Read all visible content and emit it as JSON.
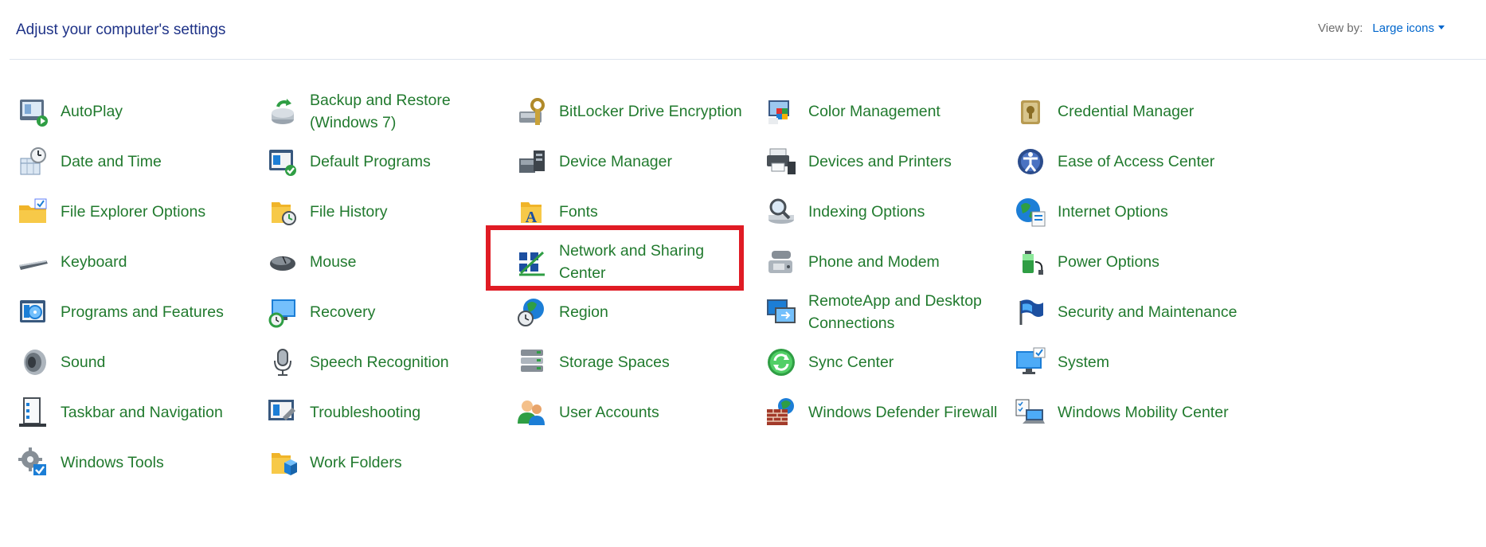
{
  "header": {
    "title": "Adjust your computer's settings",
    "view_by_label": "View by:",
    "view_by_value": "Large icons"
  },
  "items": [
    {
      "label": "AutoPlay",
      "icon": "autoplay-icon"
    },
    {
      "label": "Backup and Restore (Windows 7)",
      "icon": "backup-restore-icon"
    },
    {
      "label": "BitLocker Drive Encryption",
      "icon": "bitlocker-icon"
    },
    {
      "label": "Color Management",
      "icon": "color-management-icon"
    },
    {
      "label": "Credential Manager",
      "icon": "credential-manager-icon"
    },
    {
      "label": "Date and Time",
      "icon": "date-time-icon"
    },
    {
      "label": "Default Programs",
      "icon": "default-programs-icon"
    },
    {
      "label": "Device Manager",
      "icon": "device-manager-icon"
    },
    {
      "label": "Devices and Printers",
      "icon": "devices-printers-icon"
    },
    {
      "label": "Ease of Access Center",
      "icon": "ease-of-access-icon"
    },
    {
      "label": "File Explorer Options",
      "icon": "file-explorer-options-icon"
    },
    {
      "label": "File History",
      "icon": "file-history-icon"
    },
    {
      "label": "Fonts",
      "icon": "fonts-icon"
    },
    {
      "label": "Indexing Options",
      "icon": "indexing-options-icon"
    },
    {
      "label": "Internet Options",
      "icon": "internet-options-icon"
    },
    {
      "label": "Keyboard",
      "icon": "keyboard-icon"
    },
    {
      "label": "Mouse",
      "icon": "mouse-icon"
    },
    {
      "label": "Network and Sharing Center",
      "icon": "network-sharing-icon"
    },
    {
      "label": "Phone and Modem",
      "icon": "phone-modem-icon"
    },
    {
      "label": "Power Options",
      "icon": "power-options-icon"
    },
    {
      "label": "Programs and Features",
      "icon": "programs-features-icon"
    },
    {
      "label": "Recovery",
      "icon": "recovery-icon"
    },
    {
      "label": "Region",
      "icon": "region-icon"
    },
    {
      "label": "RemoteApp and Desktop Connections",
      "icon": "remoteapp-icon"
    },
    {
      "label": "Security and Maintenance",
      "icon": "security-maintenance-icon"
    },
    {
      "label": "Sound",
      "icon": "sound-icon"
    },
    {
      "label": "Speech Recognition",
      "icon": "speech-recognition-icon"
    },
    {
      "label": "Storage Spaces",
      "icon": "storage-spaces-icon"
    },
    {
      "label": "Sync Center",
      "icon": "sync-center-icon"
    },
    {
      "label": "System",
      "icon": "system-icon"
    },
    {
      "label": "Taskbar and Navigation",
      "icon": "taskbar-navigation-icon"
    },
    {
      "label": "Troubleshooting",
      "icon": "troubleshooting-icon"
    },
    {
      "label": "User Accounts",
      "icon": "user-accounts-icon"
    },
    {
      "label": "Windows Defender Firewall",
      "icon": "firewall-icon"
    },
    {
      "label": "Windows Mobility Center",
      "icon": "mobility-center-icon"
    },
    {
      "label": "Windows Tools",
      "icon": "windows-tools-icon"
    },
    {
      "label": "Work Folders",
      "icon": "work-folders-icon"
    }
  ],
  "highlighted_item": "Network and Sharing Center",
  "colors": {
    "title": "#1e3287",
    "link": "#217a2e",
    "view_by_value": "#0066cc",
    "highlight": "#e01b24"
  }
}
